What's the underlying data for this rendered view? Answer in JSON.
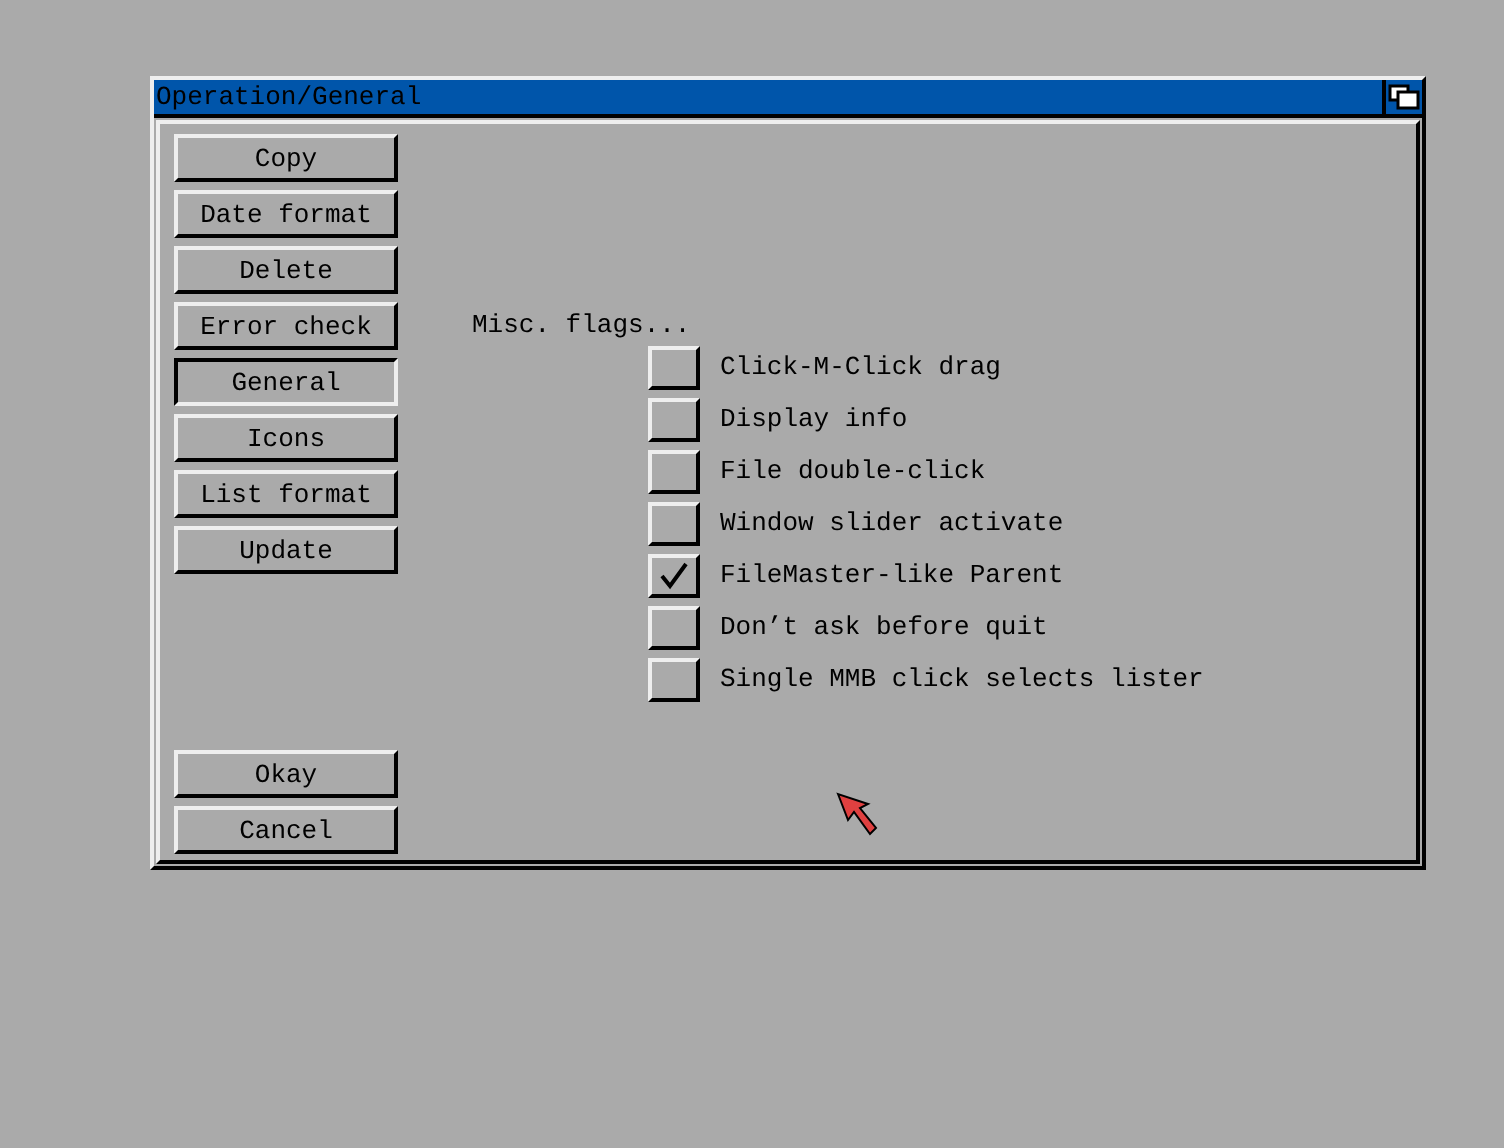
{
  "window": {
    "title": "Operation/General"
  },
  "nav_buttons": [
    {
      "label": "Copy",
      "selected": false
    },
    {
      "label": "Date format",
      "selected": false
    },
    {
      "label": "Delete",
      "selected": false
    },
    {
      "label": "Error check",
      "selected": false
    },
    {
      "label": "General",
      "selected": true
    },
    {
      "label": "Icons",
      "selected": false
    },
    {
      "label": "List format",
      "selected": false
    },
    {
      "label": "Update",
      "selected": false
    }
  ],
  "flags_heading": "Misc. flags...",
  "flags": [
    {
      "label": "Click-M-Click drag",
      "checked": false
    },
    {
      "label": "Display info",
      "checked": false
    },
    {
      "label": "File double-click",
      "checked": false
    },
    {
      "label": "Window slider activate",
      "checked": false
    },
    {
      "label": "FileMaster-like Parent",
      "checked": true
    },
    {
      "label": "Don’t ask before quit",
      "checked": false
    },
    {
      "label": "Single MMB click selects lister",
      "checked": false
    }
  ],
  "action_buttons": [
    "Okay",
    "Cancel"
  ]
}
